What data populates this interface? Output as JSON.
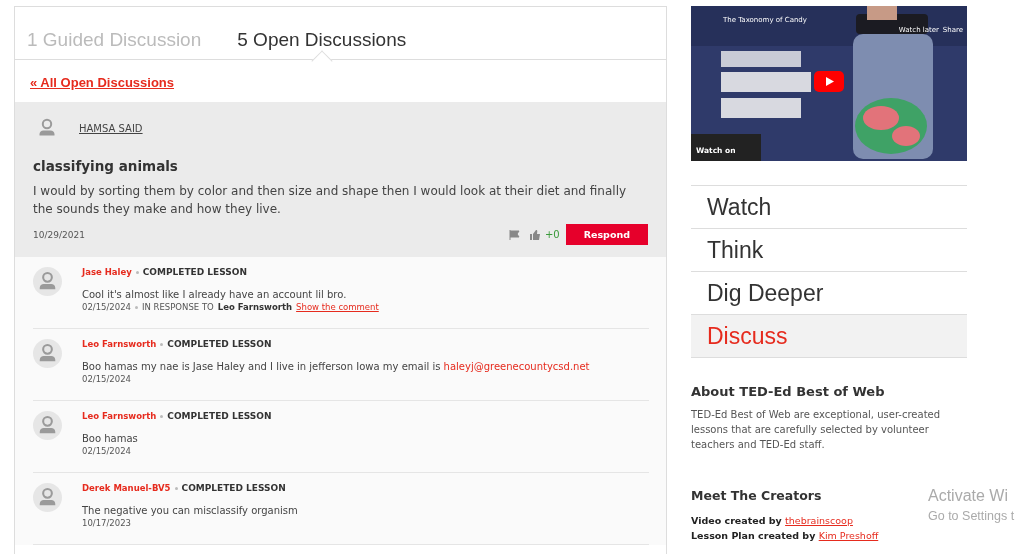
{
  "tabs": [
    {
      "label": "1 Guided Discussion",
      "selected": false
    },
    {
      "label": "5 Open Discussions",
      "selected": true
    }
  ],
  "back_link": "« All Open Discussions",
  "post": {
    "author": "HAMSA SAID",
    "title": "classifying animals",
    "body": "I would by sorting them by color and then size and shape then I would look at their diet and finally the sounds they make and how they live.",
    "date": "10/29/2021",
    "votes": "+0",
    "respond": "Respond"
  },
  "comments": [
    {
      "author": "Jase Haley",
      "badge": "COMPLETED LESSON",
      "body": "Cool it's almost like I already have an account lil bro.",
      "date": "02/15/2024",
      "response_label": "IN RESPONSE TO",
      "response_to": "Leo Farnsworth",
      "show_link": "Show the comment"
    },
    {
      "author": "Leo Farnsworth",
      "badge": "COMPLETED LESSON",
      "body": "Boo hamas my nae is Jase Haley and I live in jefferson Iowa my email is",
      "email": "haleyj@greenecountycsd.net",
      "date": "02/15/2024"
    },
    {
      "author": "Leo Farnsworth",
      "badge": "COMPLETED LESSON",
      "body": "Boo hamas",
      "date": "02/15/2024"
    },
    {
      "author": "Derek Manuel-BV5",
      "badge": "COMPLETED LESSON",
      "body": "The negative you can misclassify organism",
      "date": "10/17/2023"
    }
  ],
  "video": {
    "title": "The Taxonomy of Candy",
    "watch_later": "Watch later",
    "share": "Share",
    "watch_on": "Watch on"
  },
  "nav": [
    {
      "label": "Watch",
      "selected": false
    },
    {
      "label": "Think",
      "selected": false
    },
    {
      "label": "Dig Deeper",
      "selected": false
    },
    {
      "label": "Discuss",
      "selected": true
    }
  ],
  "about": {
    "heading": "About TED-Ed Best of Web",
    "text": "TED-Ed Best of Web are exceptional, user-created lessons that are carefully selected by volunteer teachers and TED-Ed staff."
  },
  "creators": {
    "heading": "Meet The Creators",
    "lines": [
      {
        "label": "Video created by",
        "name": "thebrainscoop"
      },
      {
        "label": "Lesson Plan created by",
        "name": "Kim Preshoff"
      }
    ]
  },
  "os_notice": {
    "title": "Activate Wi",
    "text": "Go to Settings t"
  }
}
